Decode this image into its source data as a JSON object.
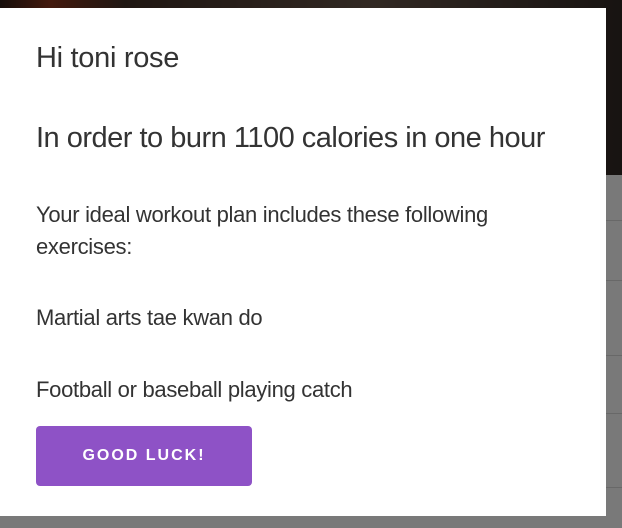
{
  "modal": {
    "greeting": "Hi toni rose",
    "heading": "In order to burn 1100 calories in one hour",
    "intro": "Your ideal workout plan includes these following exercises:",
    "exercises": [
      "Martial arts tae kwan do",
      "Football or baseball playing catch"
    ],
    "button_label": "GOOD LUCK!"
  },
  "colors": {
    "button_bg": "#8e52c6",
    "text": "#333333",
    "modal_bg": "#ffffff"
  }
}
